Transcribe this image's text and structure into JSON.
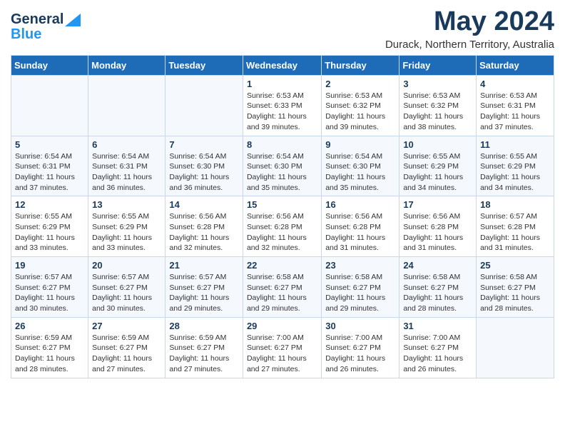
{
  "logo": {
    "line1": "General",
    "line2": "Blue"
  },
  "title": "May 2024",
  "subtitle": "Durack, Northern Territory, Australia",
  "weekdays": [
    "Sunday",
    "Monday",
    "Tuesday",
    "Wednesday",
    "Thursday",
    "Friday",
    "Saturday"
  ],
  "weeks": [
    [
      {
        "day": "",
        "info": ""
      },
      {
        "day": "",
        "info": ""
      },
      {
        "day": "",
        "info": ""
      },
      {
        "day": "1",
        "info": "Sunrise: 6:53 AM\nSunset: 6:33 PM\nDaylight: 11 hours\nand 39 minutes."
      },
      {
        "day": "2",
        "info": "Sunrise: 6:53 AM\nSunset: 6:32 PM\nDaylight: 11 hours\nand 39 minutes."
      },
      {
        "day": "3",
        "info": "Sunrise: 6:53 AM\nSunset: 6:32 PM\nDaylight: 11 hours\nand 38 minutes."
      },
      {
        "day": "4",
        "info": "Sunrise: 6:53 AM\nSunset: 6:31 PM\nDaylight: 11 hours\nand 37 minutes."
      }
    ],
    [
      {
        "day": "5",
        "info": "Sunrise: 6:54 AM\nSunset: 6:31 PM\nDaylight: 11 hours\nand 37 minutes."
      },
      {
        "day": "6",
        "info": "Sunrise: 6:54 AM\nSunset: 6:31 PM\nDaylight: 11 hours\nand 36 minutes."
      },
      {
        "day": "7",
        "info": "Sunrise: 6:54 AM\nSunset: 6:30 PM\nDaylight: 11 hours\nand 36 minutes."
      },
      {
        "day": "8",
        "info": "Sunrise: 6:54 AM\nSunset: 6:30 PM\nDaylight: 11 hours\nand 35 minutes."
      },
      {
        "day": "9",
        "info": "Sunrise: 6:54 AM\nSunset: 6:30 PM\nDaylight: 11 hours\nand 35 minutes."
      },
      {
        "day": "10",
        "info": "Sunrise: 6:55 AM\nSunset: 6:29 PM\nDaylight: 11 hours\nand 34 minutes."
      },
      {
        "day": "11",
        "info": "Sunrise: 6:55 AM\nSunset: 6:29 PM\nDaylight: 11 hours\nand 34 minutes."
      }
    ],
    [
      {
        "day": "12",
        "info": "Sunrise: 6:55 AM\nSunset: 6:29 PM\nDaylight: 11 hours\nand 33 minutes."
      },
      {
        "day": "13",
        "info": "Sunrise: 6:55 AM\nSunset: 6:29 PM\nDaylight: 11 hours\nand 33 minutes."
      },
      {
        "day": "14",
        "info": "Sunrise: 6:56 AM\nSunset: 6:28 PM\nDaylight: 11 hours\nand 32 minutes."
      },
      {
        "day": "15",
        "info": "Sunrise: 6:56 AM\nSunset: 6:28 PM\nDaylight: 11 hours\nand 32 minutes."
      },
      {
        "day": "16",
        "info": "Sunrise: 6:56 AM\nSunset: 6:28 PM\nDaylight: 11 hours\nand 31 minutes."
      },
      {
        "day": "17",
        "info": "Sunrise: 6:56 AM\nSunset: 6:28 PM\nDaylight: 11 hours\nand 31 minutes."
      },
      {
        "day": "18",
        "info": "Sunrise: 6:57 AM\nSunset: 6:28 PM\nDaylight: 11 hours\nand 31 minutes."
      }
    ],
    [
      {
        "day": "19",
        "info": "Sunrise: 6:57 AM\nSunset: 6:27 PM\nDaylight: 11 hours\nand 30 minutes."
      },
      {
        "day": "20",
        "info": "Sunrise: 6:57 AM\nSunset: 6:27 PM\nDaylight: 11 hours\nand 30 minutes."
      },
      {
        "day": "21",
        "info": "Sunrise: 6:57 AM\nSunset: 6:27 PM\nDaylight: 11 hours\nand 29 minutes."
      },
      {
        "day": "22",
        "info": "Sunrise: 6:58 AM\nSunset: 6:27 PM\nDaylight: 11 hours\nand 29 minutes."
      },
      {
        "day": "23",
        "info": "Sunrise: 6:58 AM\nSunset: 6:27 PM\nDaylight: 11 hours\nand 29 minutes."
      },
      {
        "day": "24",
        "info": "Sunrise: 6:58 AM\nSunset: 6:27 PM\nDaylight: 11 hours\nand 28 minutes."
      },
      {
        "day": "25",
        "info": "Sunrise: 6:58 AM\nSunset: 6:27 PM\nDaylight: 11 hours\nand 28 minutes."
      }
    ],
    [
      {
        "day": "26",
        "info": "Sunrise: 6:59 AM\nSunset: 6:27 PM\nDaylight: 11 hours\nand 28 minutes."
      },
      {
        "day": "27",
        "info": "Sunrise: 6:59 AM\nSunset: 6:27 PM\nDaylight: 11 hours\nand 27 minutes."
      },
      {
        "day": "28",
        "info": "Sunrise: 6:59 AM\nSunset: 6:27 PM\nDaylight: 11 hours\nand 27 minutes."
      },
      {
        "day": "29",
        "info": "Sunrise: 7:00 AM\nSunset: 6:27 PM\nDaylight: 11 hours\nand 27 minutes."
      },
      {
        "day": "30",
        "info": "Sunrise: 7:00 AM\nSunset: 6:27 PM\nDaylight: 11 hours\nand 26 minutes."
      },
      {
        "day": "31",
        "info": "Sunrise: 7:00 AM\nSunset: 6:27 PM\nDaylight: 11 hours\nand 26 minutes."
      },
      {
        "day": "",
        "info": ""
      }
    ]
  ]
}
